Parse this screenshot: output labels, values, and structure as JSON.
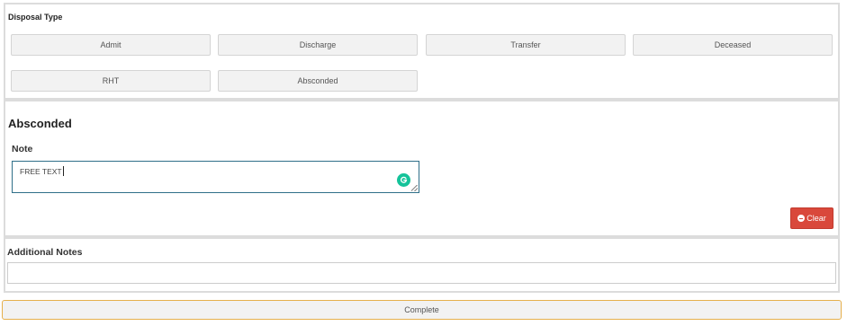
{
  "disposal": {
    "title": "Disposal Type",
    "buttons": [
      "Admit",
      "Discharge",
      "Transfer",
      "Deceased",
      "RHT",
      "Absconded"
    ]
  },
  "absconded": {
    "heading": "Absconded",
    "note_label": "Note",
    "note_value": "FREE TEXT",
    "clear_label": "Clear"
  },
  "additional": {
    "label": "Additional Notes",
    "value": ""
  },
  "complete_label": "Complete",
  "colors": {
    "clear_button": "#d9483b",
    "complete_border": "#e6b04c",
    "note_border": "#2f6f88",
    "grammar_icon": "#15c39a"
  },
  "icons": {
    "clear": "minus-circle-icon",
    "note_assistant": "grammarly-icon"
  }
}
